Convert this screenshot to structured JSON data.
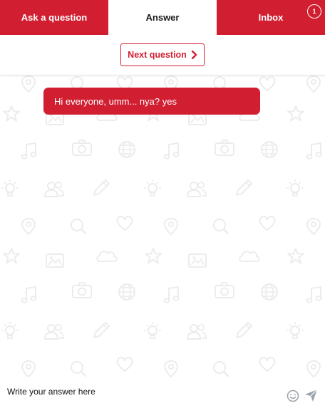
{
  "tabs": {
    "ask": "Ask a question",
    "answer": "Answer",
    "inbox": "Inbox",
    "inbox_badge": "1",
    "active": "answer"
  },
  "next_question": {
    "label": "Next question",
    "icon": "chevron-right-icon"
  },
  "chat": {
    "messages": [
      {
        "text": "Hi everyone, umm... nya? yes",
        "from": "question"
      }
    ],
    "background_pattern_icons": [
      "location-pin-icon",
      "search-icon",
      "heart-icon",
      "star-icon",
      "image-icon",
      "cloud-icon",
      "music-note-icon",
      "camera-icon",
      "globe-icon",
      "lightbulb-icon",
      "users-icon",
      "pencil-icon"
    ]
  },
  "composer": {
    "placeholder": "Write your answer here",
    "value": "",
    "emoji_icon": "smiley-icon",
    "send_icon": "send-icon"
  },
  "colors": {
    "brand_red": "#d11f31",
    "white": "#ffffff",
    "pattern_gray": "#efefef"
  }
}
